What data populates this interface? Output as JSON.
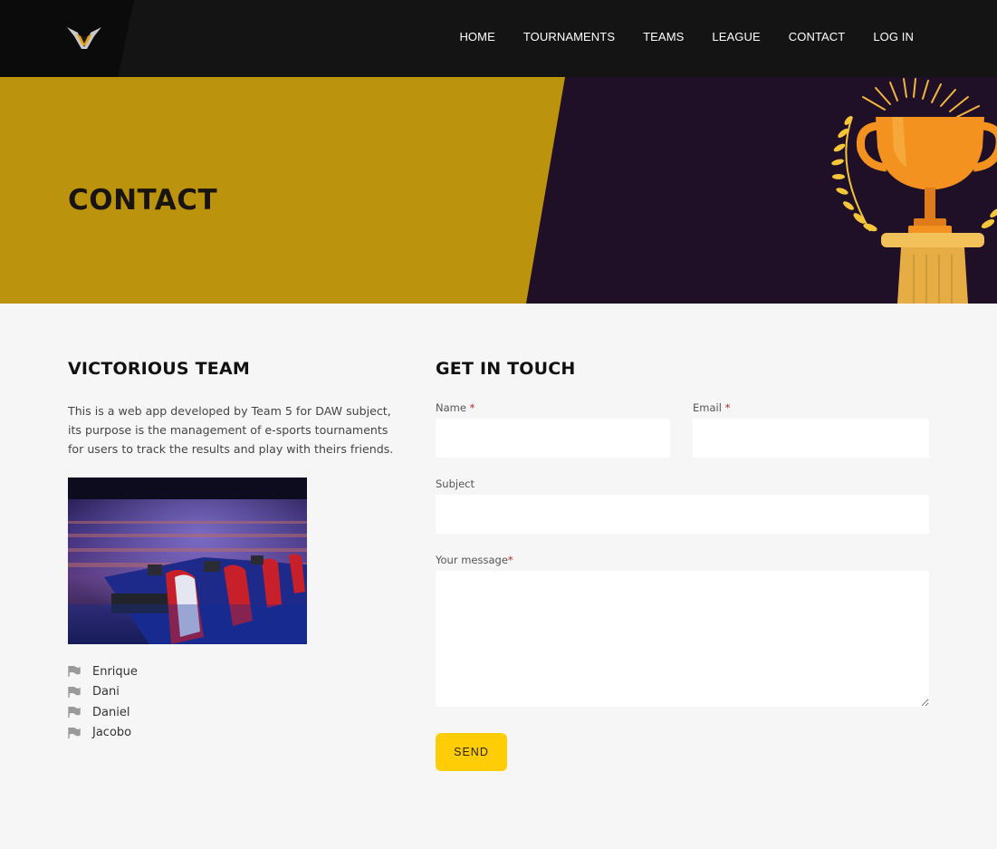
{
  "header": {
    "logo_name": "victorious-v-logo",
    "nav": [
      "HOME",
      "TOURNAMENTS",
      "TEAMS",
      "LEAGUE",
      "CONTACT",
      "LOG IN"
    ]
  },
  "hero": {
    "title": "CONTACT",
    "colors": {
      "gold": "#bc930d",
      "purple": "#1f0f27"
    }
  },
  "about": {
    "heading": "VICTORIOUS TEAM",
    "text": "This is a web app developed by Team 5 for DAW subject, its purpose is the management of e-sports tournaments for users to track the results and play with theirs friends.",
    "members": [
      "Enrique",
      "Dani",
      "Daniel",
      "Jacobo"
    ],
    "member_icon": "flag-icon"
  },
  "contact": {
    "heading": "GET IN TOUCH",
    "name_label": "Name",
    "email_label": "Email",
    "subject_label": "Subject",
    "message_label": "Your message",
    "required_mark": "*",
    "send_label": "SEND",
    "accent": "#ffcd05"
  }
}
